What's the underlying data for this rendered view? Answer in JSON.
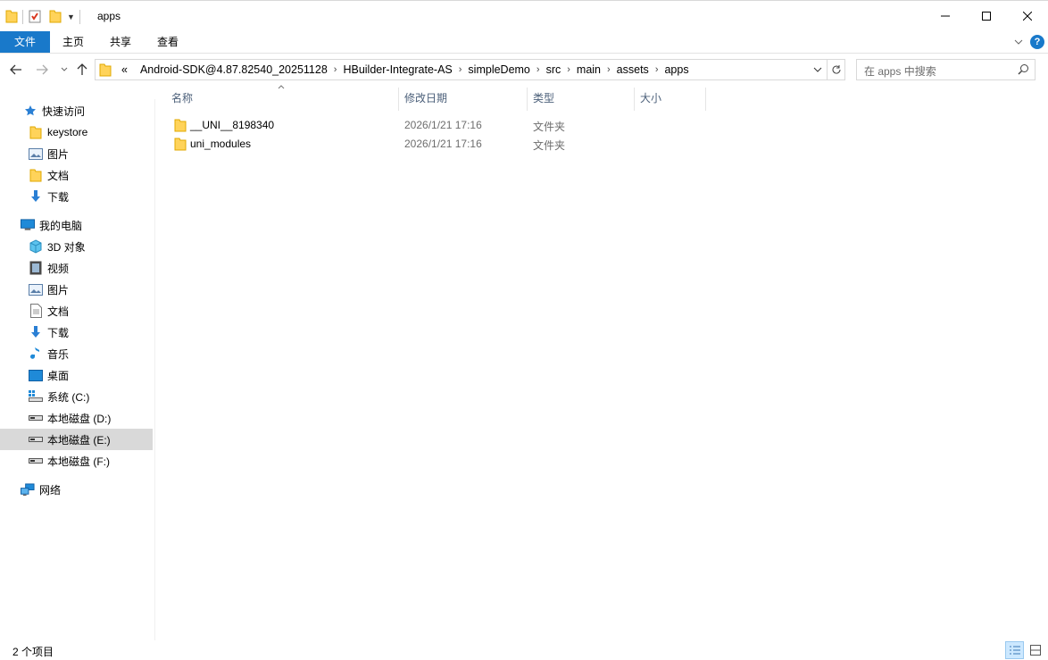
{
  "window": {
    "title": "apps",
    "controls": {
      "minimize": "minimize",
      "maximize": "maximize",
      "close": "close"
    }
  },
  "ribbon": {
    "tabs": [
      "文件",
      "主页",
      "共享",
      "查看"
    ],
    "help_label": "?"
  },
  "address": {
    "overflow": "«",
    "crumbs": [
      "Android-SDK@4.87.82540_20251128",
      "HBuilder-Integrate-AS",
      "simpleDemo",
      "src",
      "main",
      "assets",
      "apps"
    ]
  },
  "search": {
    "placeholder": "在 apps 中搜索"
  },
  "sidebar": {
    "items": [
      {
        "label": "快速访问",
        "icon": "star-icon"
      },
      {
        "label": "keystore",
        "icon": "folder-icon"
      },
      {
        "label": "图片",
        "icon": "pictures-icon"
      },
      {
        "label": "文档",
        "icon": "folder-icon"
      },
      {
        "label": "下载",
        "icon": "download-icon"
      },
      {
        "label": "我的电脑",
        "icon": "computer-icon"
      },
      {
        "label": "3D 对象",
        "icon": "cube-icon"
      },
      {
        "label": "视频",
        "icon": "video-icon"
      },
      {
        "label": "图片",
        "icon": "pictures-icon"
      },
      {
        "label": "文档",
        "icon": "document-icon"
      },
      {
        "label": "下载",
        "icon": "download-icon"
      },
      {
        "label": "音乐",
        "icon": "music-icon"
      },
      {
        "label": "桌面",
        "icon": "desktop-icon"
      },
      {
        "label": "系统 (C:)",
        "icon": "system-drive-icon"
      },
      {
        "label": "本地磁盘 (D:)",
        "icon": "drive-icon"
      },
      {
        "label": "本地磁盘 (E:)",
        "icon": "drive-icon",
        "selected": true
      },
      {
        "label": "本地磁盘 (F:)",
        "icon": "drive-icon"
      },
      {
        "label": "网络",
        "icon": "network-icon"
      }
    ]
  },
  "columns": [
    "名称",
    "修改日期",
    "类型",
    "大小"
  ],
  "files": [
    {
      "name": "__UNI__8198340",
      "date": "2026/1/21 17:16",
      "type": "文件夹"
    },
    {
      "name": "uni_modules",
      "date": "2026/1/21 17:16",
      "type": "文件夹"
    }
  ],
  "status": {
    "count": "2 个项目"
  },
  "colors": {
    "accent": "#1979ca",
    "selected": "#d9d9d9",
    "folder": "#ffd35a",
    "header_text": "#4c607a"
  }
}
